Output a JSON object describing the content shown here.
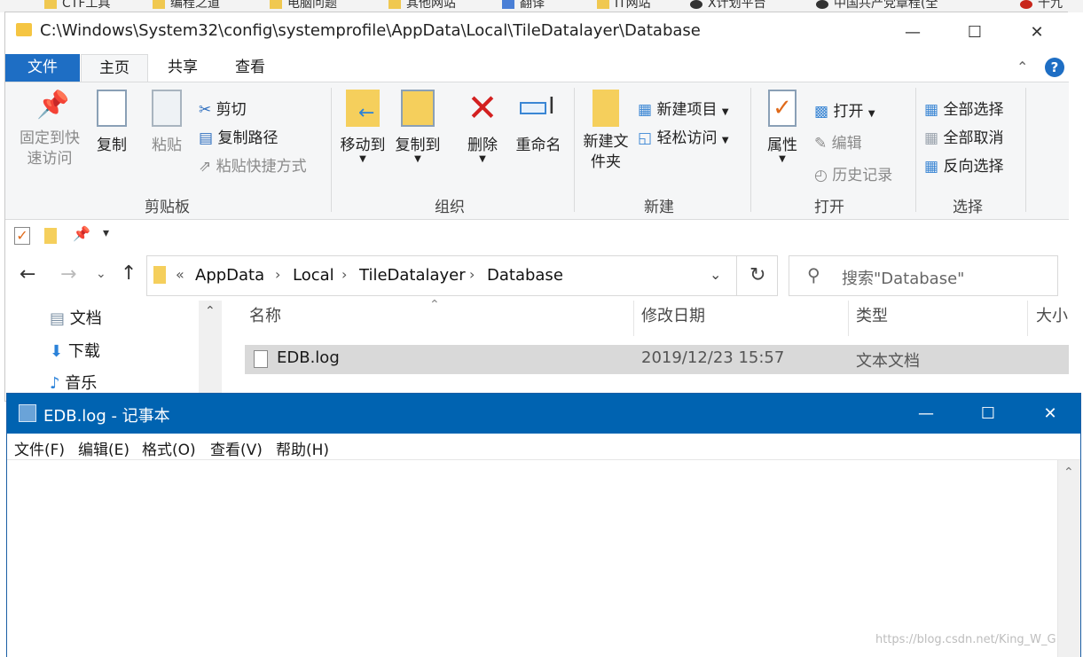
{
  "bookmarks": [
    "CTF工具",
    "编程之道",
    "电脑问题",
    "其他网站",
    "翻译",
    "IT网站",
    "X计划平台",
    "中国共产党章程(全",
    "十九"
  ],
  "explorer": {
    "title": "C:\\Windows\\System32\\config\\systemprofile\\AppData\\Local\\TileDatalayer\\Database",
    "tabs": {
      "file": "文件",
      "home": "主页",
      "share": "共享",
      "view": "查看"
    },
    "ribbon": {
      "pin": "固定到快速访问",
      "copy": "复制",
      "paste": "粘贴",
      "cut": "剪切",
      "copy_path": "复制路径",
      "paste_shortcut": "粘贴快捷方式",
      "clipboard": "剪贴板",
      "move_to": "移动到",
      "copy_to": "复制到",
      "delete": "删除",
      "rename": "重命名",
      "organize": "组织",
      "new_folder": "新建文件夹",
      "new_item": "新建项目",
      "easy_access": "轻松访问",
      "new": "新建",
      "properties": "属性",
      "open": "打开",
      "edit": "编辑",
      "history": "历史记录",
      "open_group": "打开",
      "select_all": "全部选择",
      "select_none": "全部取消",
      "invert": "反向选择",
      "select": "选择"
    },
    "breadcrumbs": [
      "AppData",
      "Local",
      "TileDatalayer",
      "Database"
    ],
    "search_placeholder": "搜索\"Database\"",
    "nav": [
      "文档",
      "下载",
      "音乐"
    ],
    "columns": [
      "名称",
      "修改日期",
      "类型",
      "大小"
    ],
    "file": {
      "name": "EDB.log",
      "date": "2019/12/23 15:57",
      "type": "文本文档"
    }
  },
  "notepad": {
    "title": "EDB.log - 记事本",
    "menu": [
      "文件(F)",
      "编辑(E)",
      "格式(O)",
      "查看(V)",
      "帮助(H)"
    ]
  },
  "watermark": "https://blog.csdn.net/King_W_G",
  "colors": {
    "accent": "#1e6ec4",
    "notepad_title": "#0063b1"
  }
}
